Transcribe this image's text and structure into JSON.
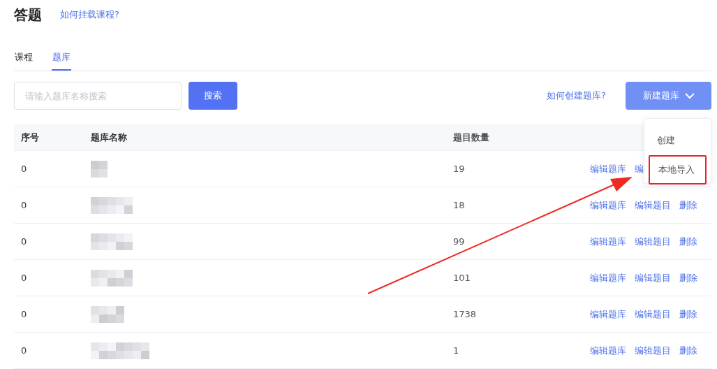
{
  "header": {
    "title": "答题",
    "help_link": "如何挂载课程?"
  },
  "tabs": [
    {
      "label": "课程",
      "selected": false
    },
    {
      "label": "题库",
      "selected": true
    }
  ],
  "search": {
    "placeholder": "请输入题库名称搜索",
    "button": "搜索"
  },
  "create_help_link": "如何创建题库?",
  "new_button": {
    "label": "新建题库",
    "expanded": true
  },
  "dropdown": [
    {
      "label": "创建",
      "highlighted": false
    },
    {
      "label": "本地导入",
      "highlighted": true
    }
  ],
  "annotation_arrow": true,
  "table": {
    "columns": [
      "序号",
      "题库名称",
      "题目数量"
    ],
    "rows": [
      {
        "index": "0",
        "name": {
          "kind": "redacted"
        },
        "count": "19",
        "actions": [
          "编辑题库",
          "编"
        ]
      },
      {
        "index": "0",
        "name": {
          "kind": "redacted"
        },
        "count": "18",
        "actions": [
          "编辑题库",
          "编辑题目",
          "删除"
        ]
      },
      {
        "index": "0",
        "name": {
          "kind": "redacted"
        },
        "count": "99",
        "actions": [
          "编辑题库",
          "编辑题目",
          "删除"
        ]
      },
      {
        "index": "0",
        "name": {
          "kind": "redacted"
        },
        "count": "101",
        "actions": [
          "编辑题库",
          "编辑题目",
          "删除"
        ]
      },
      {
        "index": "0",
        "name": {
          "kind": "redacted"
        },
        "count": "1738",
        "actions": [
          "编辑题库",
          "编辑题目",
          "删除"
        ]
      },
      {
        "index": "0",
        "name": {
          "kind": "redacted"
        },
        "count": "1",
        "actions": [
          "编辑题库",
          "编辑题目",
          "删除"
        ]
      }
    ]
  }
}
